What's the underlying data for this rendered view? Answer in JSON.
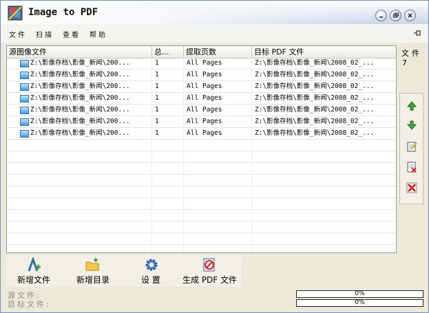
{
  "window": {
    "title": "Image to PDF"
  },
  "menu": [
    "文件",
    "扫描",
    "查看",
    "帮助"
  ],
  "table": {
    "headers": [
      "源图像文件",
      "总...",
      "提取页数",
      "目标 PDF 文件"
    ],
    "rows": [
      [
        "Z:\\影像存档\\影像_新闻\\200...",
        "1",
        "All Pages",
        "Z:\\影像存档\\影像_新闻\\2008_02_..."
      ],
      [
        "Z:\\影像存档\\影像_新闻\\200...",
        "1",
        "All Pages",
        "Z:\\影像存档\\影像_新闻\\2008_02_..."
      ],
      [
        "Z:\\影像存档\\影像_新闻\\200...",
        "1",
        "All Pages",
        "Z:\\影像存档\\影像_新闻\\2008_02_..."
      ],
      [
        "Z:\\影像存档\\影像_新闻\\200...",
        "1",
        "All Pages",
        "Z:\\影像存档\\影像_新闻\\2008_02_..."
      ],
      [
        "Z:\\影像存档\\影像_新闻\\200...",
        "1",
        "All Pages",
        "Z:\\影像存档\\影像_新闻\\2008_02_..."
      ],
      [
        "Z:\\影像存档\\影像_新闻\\200...",
        "1",
        "All Pages",
        "Z:\\影像存档\\影像_新闻\\2008_02_..."
      ],
      [
        "Z:\\影像存档\\影像_新闻\\200...",
        "1",
        "All Pages",
        "Z:\\影像存档\\影像_新闻\\2008_02_..."
      ]
    ]
  },
  "side": {
    "count_label": "文件",
    "count_value": "7"
  },
  "toolbar": {
    "add_file": "新增文件",
    "add_dir": "新增目录",
    "settings": "设 置",
    "generate": "生成 PDF 文件"
  },
  "status": {
    "source_label": "源文件:",
    "target_label": "目标文件:",
    "source_progress": "0%",
    "target_progress": "0%"
  },
  "colors": {
    "accent": "#3a6ea5",
    "green": "#3fa53a",
    "red": "#d02a2a"
  }
}
